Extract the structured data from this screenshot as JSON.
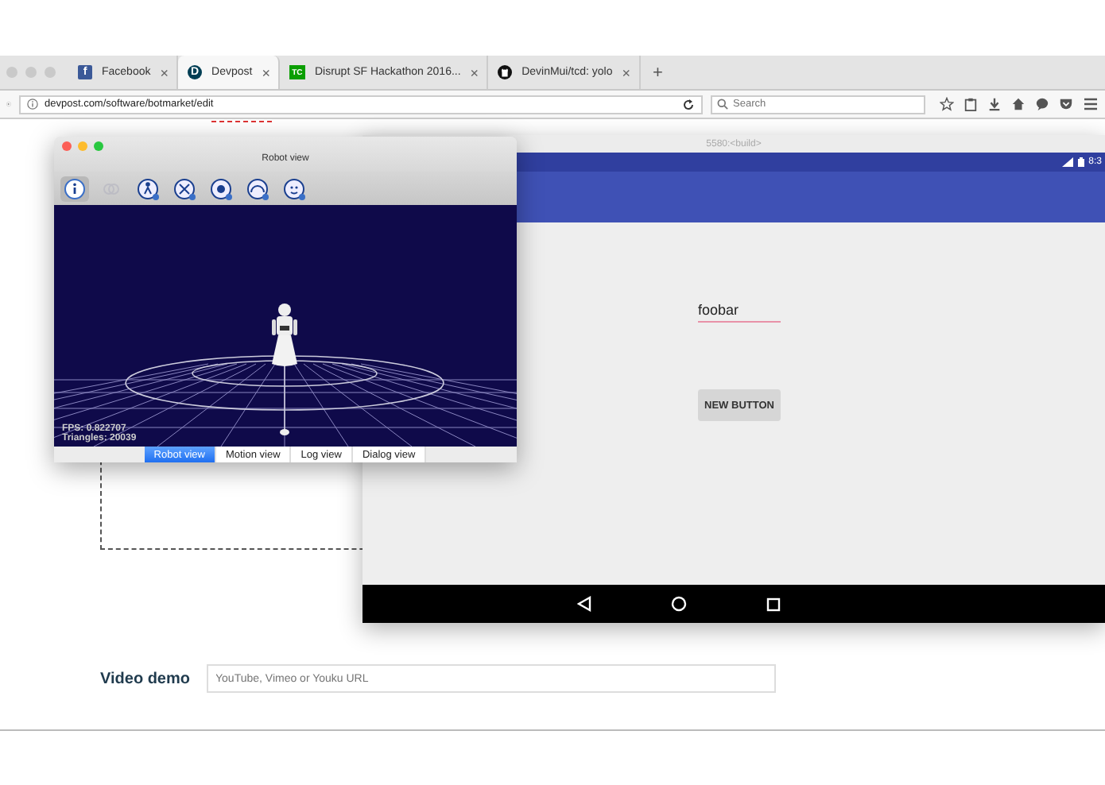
{
  "browser": {
    "tabs": [
      {
        "kind": "facebook",
        "icon_text": "f",
        "label": "Facebook",
        "close": "×",
        "selected": false
      },
      {
        "kind": "devpost",
        "icon_text": "D",
        "label": "Devpost",
        "close": "×",
        "selected": true
      },
      {
        "kind": "techcrunch",
        "icon_text": "TC",
        "label": "Disrupt SF Hackathon 2016...",
        "close": "×",
        "selected": false
      },
      {
        "kind": "github",
        "label": "DevinMui/tcd: yolo",
        "close": "×",
        "selected": false
      }
    ],
    "new_tab": "+",
    "url": "devpost.com/software/botmarket/edit",
    "search": {
      "placeholder": "Search"
    }
  },
  "page": {
    "video_demo": {
      "label": "Video demo",
      "placeholder": "YouTube, Vimeo or Youku URL"
    }
  },
  "emulator": {
    "title": "5580:<build>",
    "clock": "8:3",
    "text_field": {
      "value": "foobar"
    },
    "button": "NEW BUTTON"
  },
  "robot_view": {
    "title": "Robot view",
    "tools": [
      {
        "kind": "info",
        "selected": true,
        "disabled": false
      },
      {
        "kind": "link",
        "selected": false,
        "disabled": true
      },
      {
        "kind": "posture",
        "selected": false,
        "disabled": false
      },
      {
        "kind": "move",
        "selected": false,
        "disabled": false
      },
      {
        "kind": "settings",
        "selected": false,
        "disabled": false
      },
      {
        "kind": "gauge",
        "selected": false,
        "disabled": false
      },
      {
        "kind": "face",
        "selected": false,
        "disabled": false
      }
    ],
    "fps": "FPS: 0.822707",
    "triangles": "Triangles: 20039",
    "tabs": [
      {
        "label": "Robot view",
        "selected": true
      },
      {
        "label": "Motion view",
        "selected": false
      },
      {
        "label": "Log view",
        "selected": false
      },
      {
        "label": "Dialog view",
        "selected": false
      }
    ]
  }
}
